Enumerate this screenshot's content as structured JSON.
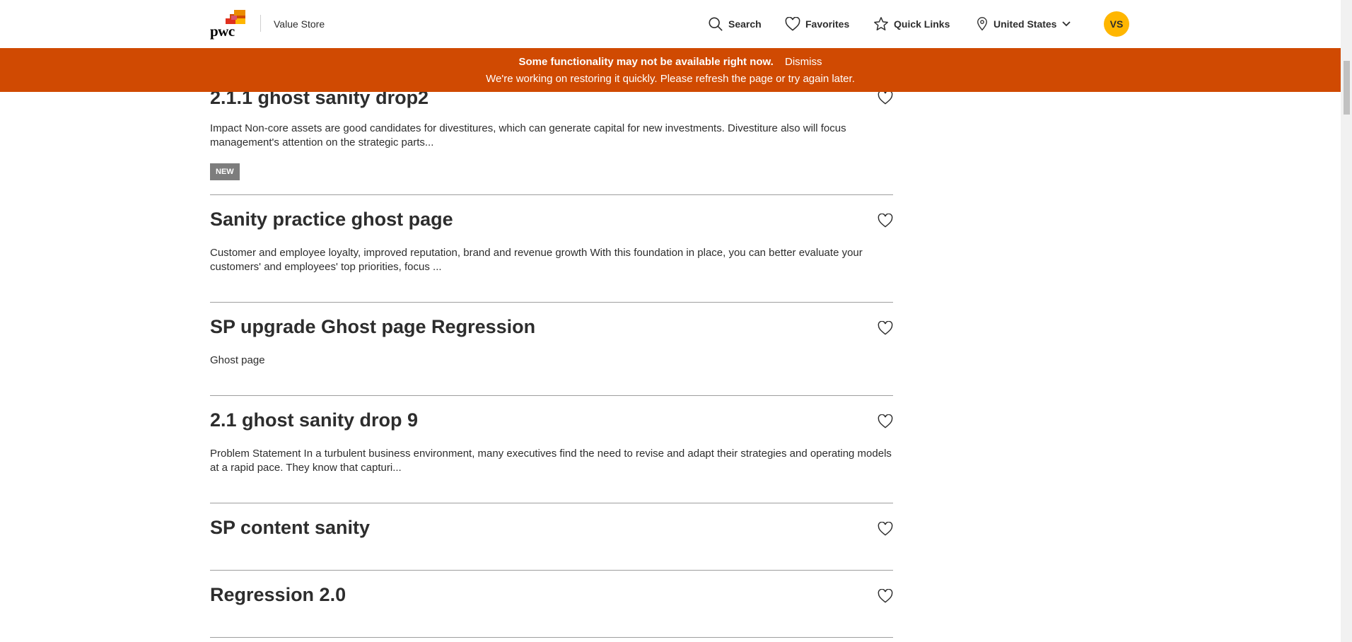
{
  "header": {
    "logo_text": "pwc",
    "app_name": "Value Store",
    "nav": {
      "search": "Search",
      "favorites": "Favorites",
      "quick_links": "Quick Links",
      "region": "United States"
    },
    "avatar_initials": "VS"
  },
  "banner": {
    "headline": "Some functionality may not be available right now.",
    "dismiss": "Dismiss",
    "message": "We're working on restoring it quickly. Please refresh the page or try again later.",
    "color": "#d04a02"
  },
  "colors": {
    "brand_orange": "#d04a02",
    "avatar_yellow": "#ffb600",
    "badge_gray": "#7d7d7d"
  },
  "items": [
    {
      "title": "2.1.1 ghost sanity drop2",
      "description": "Impact Non-core assets are good candidates for divestitures, which can generate capital for new investments. Divestiture also will focus management's attention on the strategic parts...",
      "badge": "NEW"
    },
    {
      "title": "Sanity practice ghost page",
      "description": "Customer and employee loyalty, improved reputation, brand and revenue growth With this foundation in place, you can better evaluate your customers' and employees' top priorities, focus ..."
    },
    {
      "title": "SP upgrade Ghost page Regression",
      "description": "Ghost page"
    },
    {
      "title": "2.1 ghost sanity drop 9",
      "description": "Problem Statement In a turbulent business environment, many executives find the need to revise and adapt their strategies and operating models at a rapid pace. They know that capturi..."
    },
    {
      "title": "SP content sanity",
      "description": ""
    },
    {
      "title": "Regression 2.0",
      "description": ""
    }
  ]
}
